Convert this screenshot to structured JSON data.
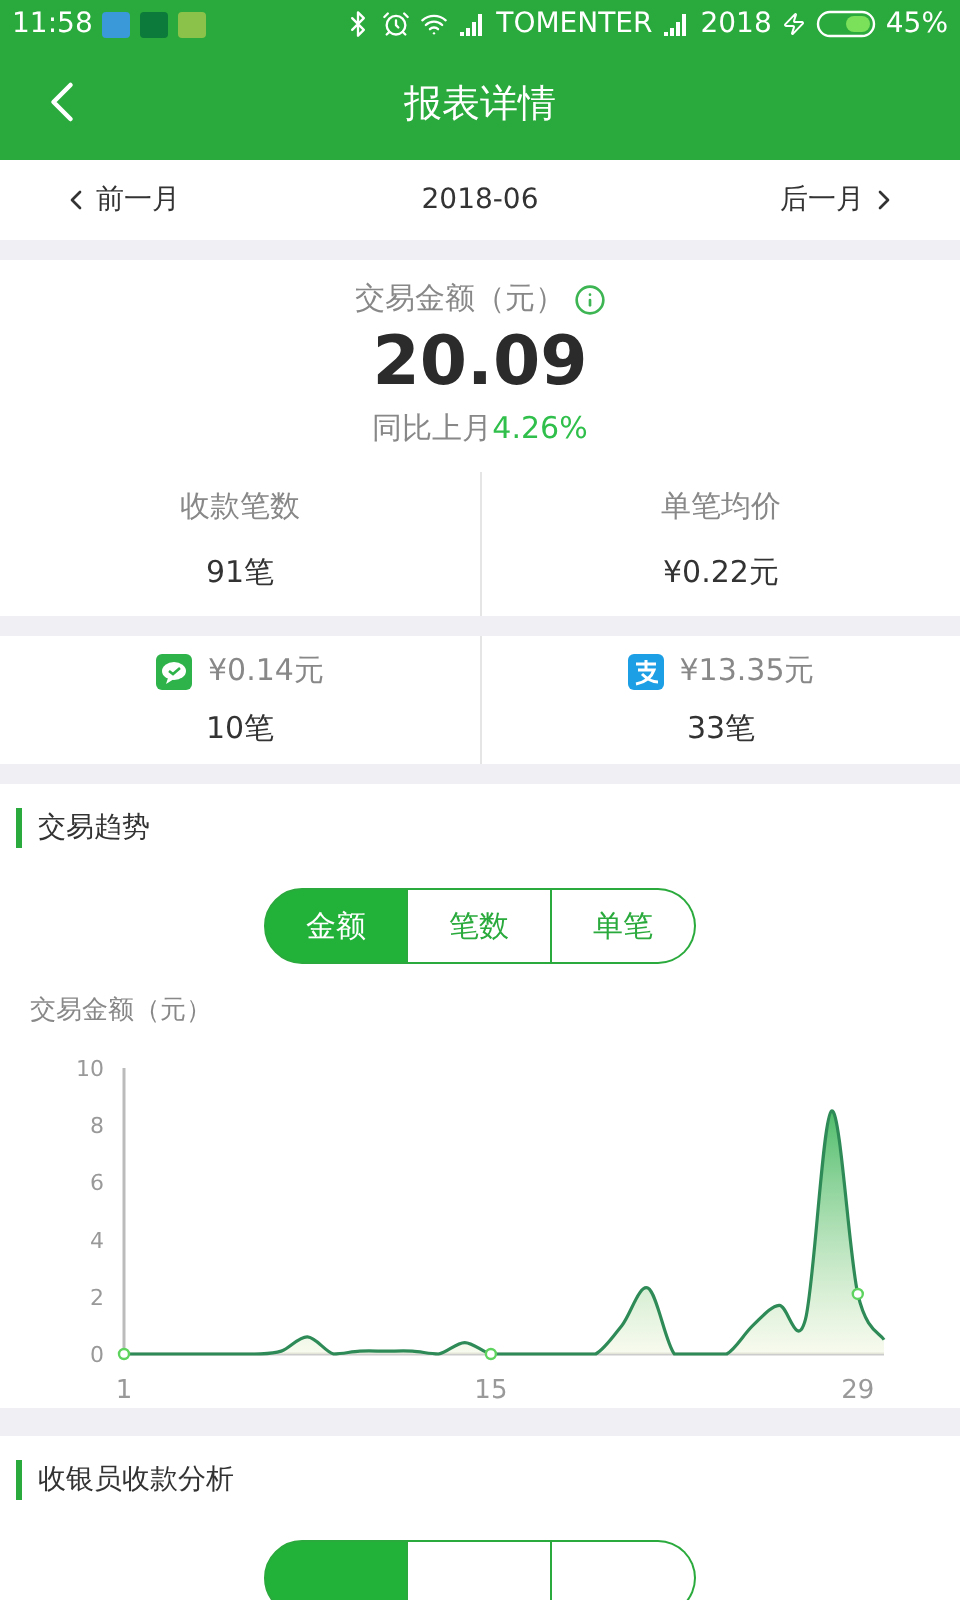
{
  "status_bar": {
    "time": "11:58",
    "carrier": "TOMENTER",
    "signal_label": "2018",
    "battery": "45%"
  },
  "header": {
    "title": "报表详情"
  },
  "month_nav": {
    "prev": "前一月",
    "current": "2018-06",
    "next": "后一月"
  },
  "summary": {
    "label": "交易金额（元）",
    "amount": "20.09",
    "compare_label": "同比上月",
    "compare_value": "4.26%",
    "stats": [
      {
        "label": "收款笔数",
        "value": "91笔"
      },
      {
        "label": "单笔均价",
        "value": "¥0.22元"
      }
    ]
  },
  "payments": [
    {
      "kind": "wechat",
      "amount": "¥0.14元",
      "count": "10笔"
    },
    {
      "kind": "alipay",
      "amount": "¥13.35元",
      "count": "33笔"
    }
  ],
  "trend": {
    "title": "交易趋势",
    "tabs": [
      {
        "label": "金额",
        "selected": true
      },
      {
        "label": "笔数",
        "selected": false
      },
      {
        "label": "单笔",
        "selected": false
      }
    ],
    "chart_data": {
      "type": "area",
      "ylabel": "交易金额（元）",
      "x": [
        1,
        2,
        3,
        4,
        5,
        6,
        7,
        8,
        9,
        10,
        11,
        12,
        13,
        14,
        15,
        16,
        17,
        18,
        19,
        20,
        21,
        22,
        23,
        24,
        25,
        26,
        27,
        28,
        29,
        30
      ],
      "series": [
        {
          "color": "#2e8b57",
          "values": [
            0,
            0,
            0,
            0,
            0,
            0,
            0.1,
            0.6,
            0,
            0.1,
            0.1,
            0.1,
            0,
            0.4,
            0,
            0,
            0,
            0,
            0,
            1.0,
            2.3,
            0,
            0,
            0,
            1.0,
            1.7,
            1.2,
            8.5,
            2.1,
            0.5
          ]
        }
      ],
      "xlim": [
        1,
        30
      ],
      "ylim": [
        0,
        10
      ],
      "xticks": [
        1,
        15,
        29
      ],
      "yticks": [
        0,
        2,
        4,
        6,
        8,
        10
      ]
    }
  },
  "cashier": {
    "title": "收银员收款分析",
    "tabs": [
      {
        "selected": true
      },
      {
        "selected": false
      },
      {
        "selected": false
      }
    ]
  }
}
